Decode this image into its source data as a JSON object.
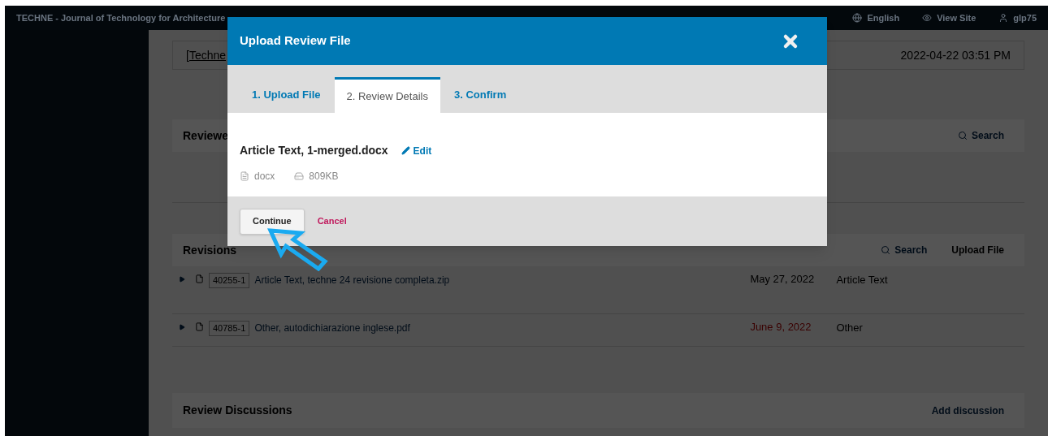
{
  "header": {
    "site_title": "TECHNE - Journal of Technology for Architecture",
    "links": [
      {
        "kind": "globe",
        "label": "English"
      },
      {
        "kind": "eye",
        "label": "View Site"
      },
      {
        "kind": "user",
        "label": "glp75"
      }
    ]
  },
  "top_card": {
    "title": "[Techne",
    "date": "2022-04-22 03:51 PM"
  },
  "reviewer_files": {
    "title": "Reviewe",
    "search": "Search"
  },
  "revisions": {
    "title": "Revisions",
    "search": "Search",
    "upload": "Upload File",
    "rows": [
      {
        "id": "40255-1",
        "name": "Article Text, techne 24 revisione completa.zip",
        "date": "May 27, 2022",
        "overdue": false,
        "type": "Article Text"
      },
      {
        "id": "40785-1",
        "name": "Other, autodichiarazione inglese.pdf",
        "date": "June 9, 2022",
        "overdue": true,
        "type": "Other"
      }
    ]
  },
  "review_discussions": {
    "title": "Review Discussions",
    "action": "Add discussion"
  },
  "modal": {
    "title": "Upload Review File",
    "tabs": [
      {
        "label": "1. Upload File",
        "selected": false
      },
      {
        "label": "2. Review Details",
        "selected": true
      },
      {
        "label": "3. Confirm",
        "selected": false
      }
    ],
    "file": {
      "name": "Article Text, 1-merged.docx",
      "edit": "Edit",
      "format": "docx",
      "size": "809KB"
    },
    "continue": "Continue",
    "cancel": "Cancel"
  }
}
